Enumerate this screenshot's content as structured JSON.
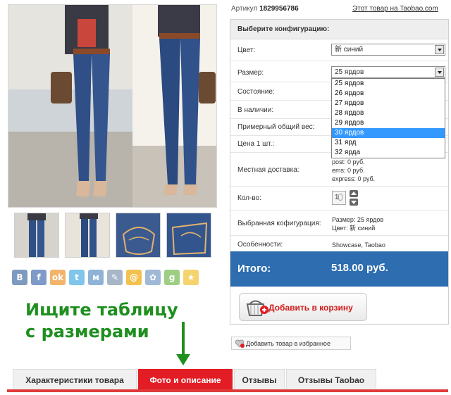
{
  "product": {
    "sku_label": "Артикул",
    "sku_value": "1829956786",
    "taobao_link": "Этот товар на Taobao.com"
  },
  "gallery": {
    "thumb_count": 4
  },
  "social_icons": [
    {
      "name": "vkontakte-icon",
      "glyph": "В",
      "color": "#7e9bbf"
    },
    {
      "name": "facebook-icon",
      "glyph": "f",
      "color": "#7f99c8"
    },
    {
      "name": "odnoklassniki-icon",
      "glyph": "ok",
      "color": "#f2b36b"
    },
    {
      "name": "twitter-icon",
      "glyph": "t",
      "color": "#7fc6ea"
    },
    {
      "name": "myworld-icon",
      "glyph": "м",
      "color": "#8fb3d6"
    },
    {
      "name": "livejournal-icon",
      "glyph": "✎",
      "color": "#a7b7c9"
    },
    {
      "name": "mailru-icon",
      "glyph": "@",
      "color": "#f2c14e"
    },
    {
      "name": "settings-share-icon",
      "glyph": "✿",
      "color": "#9fb9d6"
    },
    {
      "name": "googleplus-icon",
      "glyph": "g",
      "color": "#9dcf83"
    },
    {
      "name": "favorite-star-icon",
      "glyph": "★",
      "color": "#f5d36e"
    }
  ],
  "hint": {
    "line1": "Ищите таблицу",
    "line2": "с размерами",
    "color": "#1f8f1f"
  },
  "config": {
    "header": "Выберите конфигурацию:",
    "color_label": "Цвет:",
    "color_value": "新 синий",
    "size_label": "Размер:",
    "size_value": "25 ярдов",
    "size_options": [
      "25 ярдов",
      "26 ярдов",
      "27 ярдов",
      "28 ярдов",
      "29 ярдов",
      "30 ярдов",
      "31 ярд",
      "32 ярда"
    ],
    "size_highlighted": "30 ярдов",
    "condition_label": "Состояние:",
    "stock_label": "В наличии:",
    "weight_label": "Примерный общий вес:",
    "price_label": "Цена 1 шт.:",
    "delivery_label": "Местная доставка:",
    "delivery_post": "post: 0 руб.",
    "delivery_ems": "ems: 0 руб.",
    "delivery_express": "express: 0 руб.",
    "qty_label": "Кол-во:",
    "qty_value": "1",
    "selected_label": "Выбранная кофигурация:",
    "selected_size": "Размер: 25 ярдов",
    "selected_color": "Цвет: 新 синий",
    "features_label": "Особенности:",
    "features_value": "Showcase, Taobao"
  },
  "total": {
    "label": "Итого:",
    "value": "518.00 руб.",
    "color": "#2d6db0"
  },
  "actions": {
    "add_to_cart": "Добавить в корзину",
    "add_to_favorites": "Добавить товар в избранное"
  },
  "tabs": [
    {
      "label": "Характеристики товара",
      "active": false
    },
    {
      "label": "Фото и описание",
      "active": true
    },
    {
      "label": "Отзывы",
      "active": false
    },
    {
      "label": "Отзывы Taobao",
      "active": false
    }
  ]
}
